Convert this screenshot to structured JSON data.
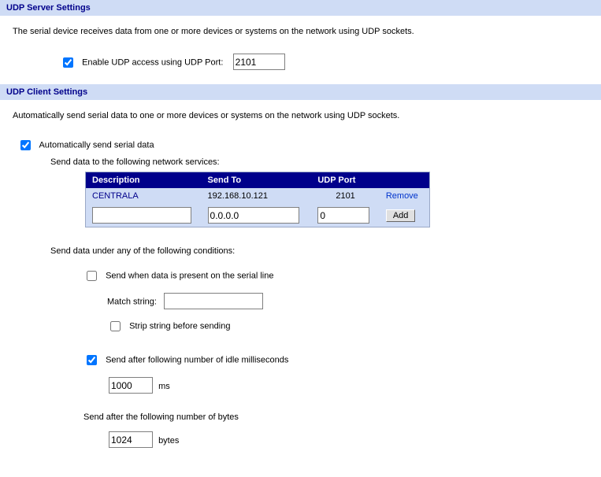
{
  "server": {
    "header": "UDP Server Settings",
    "desc": "The serial device receives data from one or more devices or systems on the network using UDP sockets.",
    "enable_label": "Enable UDP access using UDP Port:",
    "port_value": "2101"
  },
  "client": {
    "header": "UDP Client Settings",
    "desc": "Automatically send serial data to one or more devices or systems on the network using UDP sockets.",
    "auto_label": "Automatically send serial data",
    "send_to_label": "Send data to the following network services:",
    "table": {
      "col_desc": "Description",
      "col_sendto": "Send To",
      "col_port": "UDP Port",
      "row": {
        "desc": "CENTRALA",
        "sendto": "192.168.10.121",
        "port": "2101",
        "remove": "Remove"
      },
      "new": {
        "desc": "",
        "sendto": "0.0.0.0",
        "port": "0",
        "add": "Add"
      }
    },
    "cond_label": "Send data under any of the following conditions:",
    "cond_present": "Send when data is present on the serial line",
    "match_label": "Match string:",
    "match_value": "",
    "strip_label": "Strip string before sending",
    "cond_idle": "Send after following number of idle milliseconds",
    "idle_value": "1000",
    "idle_unit": "ms",
    "cond_bytes": "Send after the following number of bytes",
    "bytes_value": "1024",
    "bytes_unit": "bytes"
  }
}
